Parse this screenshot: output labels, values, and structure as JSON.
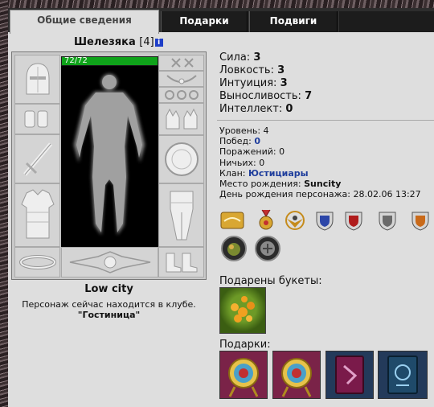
{
  "tabs": [
    {
      "label": "Общие сведения",
      "active": true
    },
    {
      "label": "Подарки",
      "active": false
    },
    {
      "label": "Подвиги",
      "active": false
    }
  ],
  "character": {
    "name": "Шелезяка",
    "level_text": "[4]",
    "info_glyph": "i",
    "hp_text": "72/72",
    "hp_fraction": 1.0
  },
  "equipment_slots": [
    "helmet-icon",
    "amulet-icon",
    "ring-icon",
    "gloves-icon",
    "bracers-icon",
    "sword-icon",
    "shield-icon",
    "armor-icon",
    "greaves-icon",
    "belt-icon",
    "emblem-icon",
    "boots-icon"
  ],
  "location": {
    "title": "Low city",
    "message": "Персонаж сейчас находится в клубе.",
    "place": "\"Гостиница\""
  },
  "stats": [
    {
      "label": "Сила:",
      "value": "3"
    },
    {
      "label": "Ловкость:",
      "value": "3"
    },
    {
      "label": "Интуиция:",
      "value": "3"
    },
    {
      "label": "Выносливость:",
      "value": "7"
    },
    {
      "label": "Интеллект:",
      "value": "0"
    }
  ],
  "info": {
    "level_label": "Уровень:",
    "level_value": "4",
    "wins_label": "Побед:",
    "wins_value": "0",
    "losses_label": "Поражений:",
    "losses_value": "0",
    "draws_label": "Ничьих:",
    "draws_value": "0",
    "clan_label": "Клан:",
    "clan_value": "Юстициары",
    "birthplace_label": "Место рождения:",
    "birthplace_value": "Suncity",
    "birthday_label": "День рождения персонажа:",
    "birthday_value": "28.02.06 13:27"
  },
  "badges_row1": [
    "handshake-icon",
    "medal-icon",
    "eagle-emblem-icon",
    "blue-shield-icon",
    "red-shield-icon",
    "grey-shield-icon",
    "orange-shield-icon"
  ],
  "badges_row2": [
    "fruit-orb-icon",
    "stone-orb-icon"
  ],
  "bouquets_label": "Подарены букеты:",
  "gifts_label": "Подарки:",
  "gifts": [
    "target-gift-icon",
    "target-gift-icon",
    "red-book-icon",
    "blue-book-icon"
  ]
}
